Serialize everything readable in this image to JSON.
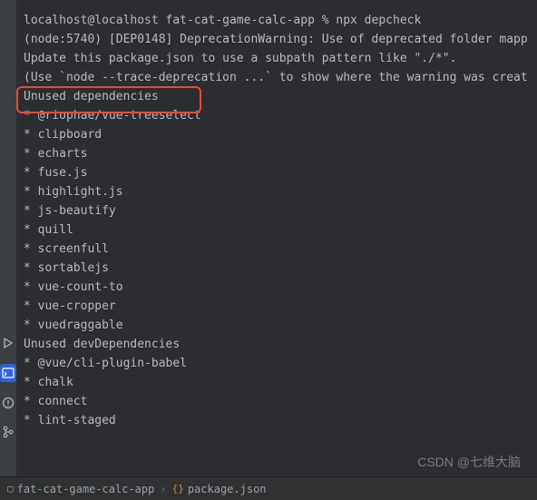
{
  "terminal": {
    "lines": [
      "localhost@localhost fat-cat-game-calc-app % npx depcheck",
      "(node:5740) [DEP0148] DeprecationWarning: Use of deprecated folder mapp",
      "Update this package.json to use a subpath pattern like \"./*\".",
      "(Use `node --trace-deprecation ...` to show where the warning was creat",
      "Unused dependencies",
      "* @riophae/vue-treeselect",
      "* clipboard",
      "* echarts",
      "* fuse.js",
      "* highlight.js",
      "* js-beautify",
      "* quill",
      "* screenfull",
      "* sortablejs",
      "* vue-count-to",
      "* vue-cropper",
      "* vuedraggable",
      "Unused devDependencies",
      "* @vue/cli-plugin-babel",
      "* chalk",
      "* connect",
      "* lint-staged"
    ]
  },
  "statusBar": {
    "project": "fat-cat-game-calc-app",
    "file": "package.json"
  },
  "watermark": "CSDN @七维大脑"
}
